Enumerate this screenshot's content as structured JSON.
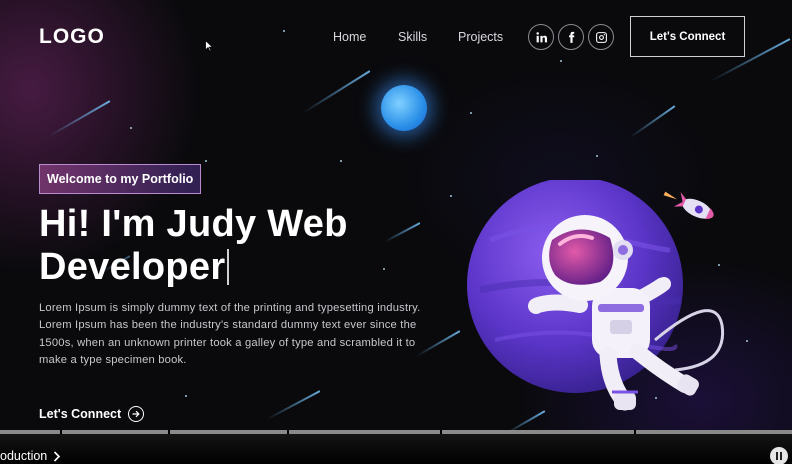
{
  "header": {
    "logo": "LOGO",
    "nav": [
      {
        "label": "Home"
      },
      {
        "label": "Skills"
      },
      {
        "label": "Projects"
      }
    ],
    "social_icons": [
      "linkedin-icon",
      "facebook-icon",
      "instagram-icon"
    ],
    "connect_label": "Let's Connect"
  },
  "hero": {
    "tagline": "Welcome to my Portfolio",
    "title_line1": "Hi! I'm Judy Web",
    "title_line2": "Developer",
    "description": "Lorem Ipsum is simply dummy text of the printing and typesetting industry. Lorem Ipsum has been the industry's standard dummy text ever since the 1500s, when an unknown printer took a galley of type and scrambled it to make a type specimen book.",
    "cta_label": "Let's Connect"
  },
  "video": {
    "chapter": "oduction",
    "progress": 0.0
  },
  "colors": {
    "background": "#0a0a0d",
    "accent_purple": "#6b3fd0",
    "accent_pink": "#b0509e",
    "planet_blue": "#2a8fe8"
  }
}
